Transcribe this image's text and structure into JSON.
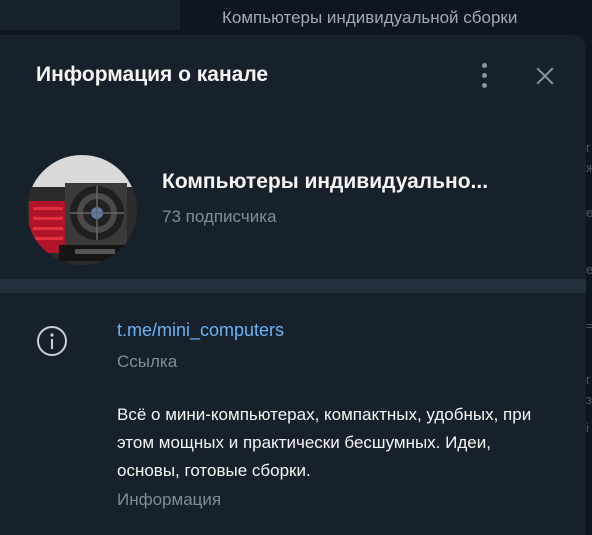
{
  "background": {
    "chat_title": "Компьютеры индивидуальной сборки"
  },
  "panel": {
    "title": "Информация о канале",
    "menu_icon": "more-vertical-icon",
    "close_icon": "close-icon"
  },
  "channel": {
    "name": "Компьютеры индивидуально...",
    "subscribers": "73 подписчика"
  },
  "info": {
    "icon": "info-icon",
    "link": "t.me/mini_computers",
    "link_caption": "Ссылка",
    "description": "Всё о мини-компьютерах, компактных, удобных, при этом мощных и практически бесшумных. Идеи, основы, готовые сборки.",
    "description_caption": "Информация"
  },
  "colors": {
    "background": "#0e1621",
    "panel": "#17212b",
    "divider": "#232e3c",
    "link": "#6ab3f3",
    "secondary_text": "#7f8d9b",
    "primary_text": "#f5f5f5"
  }
}
